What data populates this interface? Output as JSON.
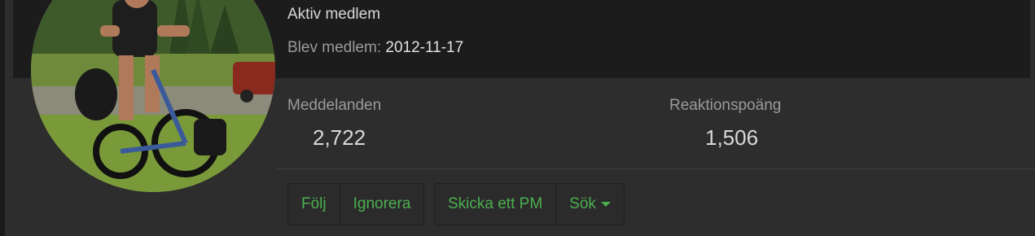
{
  "profile": {
    "user_title": "Aktiv medlem",
    "joined_label": "Blev medlem:",
    "joined_value": "2012-11-17"
  },
  "stats": [
    {
      "label": "Meddelanden",
      "value": "2,722"
    },
    {
      "label": "Reaktionspoäng",
      "value": "1,506"
    }
  ],
  "buttons": {
    "follow": "Följ",
    "ignore": "Ignorera",
    "send_pm": "Skicka ett PM",
    "search": "Sök"
  },
  "colors": {
    "accent": "#4caf50",
    "background": "#2d2d2d",
    "header": "#1c1c1c"
  },
  "icons": {
    "search_dropdown": "caret-down-icon"
  }
}
